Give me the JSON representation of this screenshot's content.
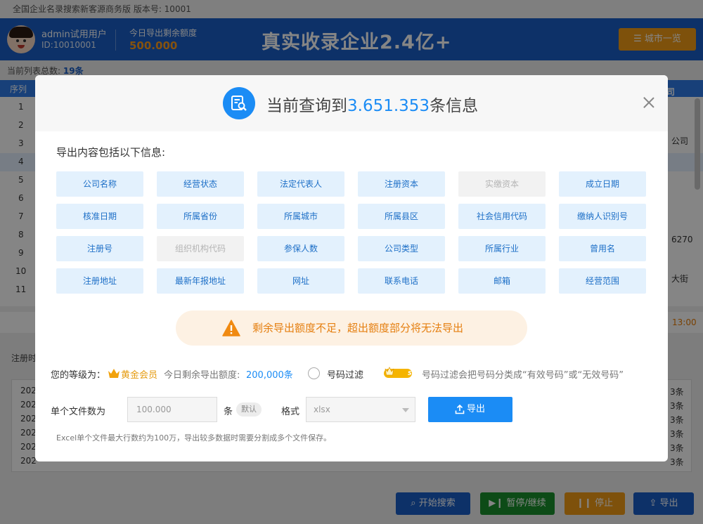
{
  "app": {
    "title": "全国企业名录搜索新客源商务版   版本号: 10001"
  },
  "header": {
    "user_name": "admin试用用户",
    "user_id": "ID:10010001",
    "quota_label": "今日导出剩余额度",
    "quota_value": "500.000",
    "slogan": "真实收录企业2.4亿+",
    "city_button": "城市一览"
  },
  "list": {
    "count_prefix": "当前列表总数:",
    "count_value": "19条",
    "seq_header": "序列",
    "company_header": "司",
    "rows": [
      "1",
      "2",
      "3",
      "4",
      "5",
      "6",
      "7",
      "8",
      "9",
      "10",
      "11"
    ],
    "right_fragments": {
      "r3": "公司",
      "r8": "6270",
      "r10": "大街"
    },
    "mid_value": "13:00"
  },
  "log": {
    "label": "注册时",
    "lines": [
      "202",
      "202",
      "202",
      "202",
      "202",
      "202"
    ],
    "right": "3条"
  },
  "bottom_buttons": {
    "start": "开始搜索",
    "pause": "暂停/继续",
    "stop": "停止",
    "export": "导出"
  },
  "modal": {
    "title_prefix": "当前查询到",
    "title_count": "3.651.353",
    "title_suffix": "条信息",
    "section_title": "导出内容包括以下信息:",
    "fields": [
      {
        "label": "公司名称",
        "disabled": false
      },
      {
        "label": "经营状态",
        "disabled": false
      },
      {
        "label": "法定代表人",
        "disabled": false
      },
      {
        "label": "注册资本",
        "disabled": false
      },
      {
        "label": "实缴资本",
        "disabled": true
      },
      {
        "label": "成立日期",
        "disabled": false
      },
      {
        "label": "核准日期",
        "disabled": false
      },
      {
        "label": "所属省份",
        "disabled": false
      },
      {
        "label": "所属城市",
        "disabled": false
      },
      {
        "label": "所属县区",
        "disabled": false
      },
      {
        "label": "社会信用代码",
        "disabled": false
      },
      {
        "label": "缴纳人识别号",
        "disabled": false
      },
      {
        "label": "注册号",
        "disabled": false
      },
      {
        "label": "组织机构代码",
        "disabled": true
      },
      {
        "label": "参保人数",
        "disabled": false
      },
      {
        "label": "公司类型",
        "disabled": false
      },
      {
        "label": "所属行业",
        "disabled": false
      },
      {
        "label": "曾用名",
        "disabled": false
      },
      {
        "label": "注册地址",
        "disabled": false
      },
      {
        "label": "最新年报地址",
        "disabled": false
      },
      {
        "label": "网址",
        "disabled": false
      },
      {
        "label": "联系电话",
        "disabled": false
      },
      {
        "label": "邮箱",
        "disabled": false
      },
      {
        "label": "经营范围",
        "disabled": false
      }
    ],
    "warning": "剩余导出额度不足，超出额度部分将无法导出",
    "level_label": "您的等级为：",
    "level_value": "黄金会员",
    "quota_label": "今日剩余导出额度:",
    "quota_value": "200,000条",
    "filter_label": "号码过滤",
    "svip_badge": "SVIP",
    "filter_desc": "号码过滤会把号码分类成“有效号码”或“无效号码”",
    "file_count_label": "单个文件数为",
    "file_count_value": "100.000",
    "file_unit": "条",
    "default_tag": "默认",
    "format_label": "格式",
    "format_value": "xlsx",
    "export_button": "导出",
    "note": "Excel单个文件最大行数约为100万，导出较多数据时需要分割成多个文件保存。"
  },
  "colors": {
    "primary": "#1b8cf5",
    "header_bg": "#1a5fc8",
    "warning": "#e57f10",
    "gold": "#e59b10"
  }
}
